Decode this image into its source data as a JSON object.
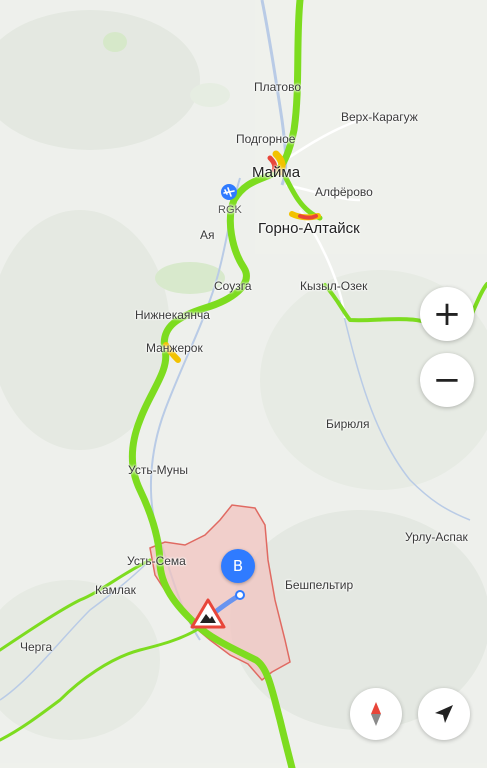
{
  "places": {
    "platovo": "Платово",
    "verkh_karaguzh": "Верх-Карагуж",
    "podgornoe": "Подгорное",
    "mayma": "Майма",
    "alferovo": "Алфёрово",
    "rgk": "RGK",
    "gorno_altaysk": "Горно-Алтайск",
    "aya": "Ая",
    "souzga": "Соузга",
    "kyzyl_ozek": "Кызыл-Озек",
    "nizhnekayancha": "Нижнекаянча",
    "manzherok": "Манжерок",
    "biryulya": "Бирюля",
    "ust_muny": "Усть-Муны",
    "urlu_aspak": "Урлу-Аспак",
    "ust_sema": "Усть-Сема",
    "beshpeltir": "Бешпельтир",
    "kamlak": "Камлак",
    "cherga": "Черга"
  },
  "marker": {
    "label": "B"
  },
  "controls": {
    "zoom_in": "+",
    "zoom_out": "−"
  },
  "icons": {
    "airport": "airplane-icon",
    "warning": "road-warning-icon",
    "compass": "compass-icon",
    "location": "navigation-arrow-icon"
  },
  "colors": {
    "traffic_free": "#7ddc1f",
    "traffic_slow": "#f2c200",
    "traffic_jam": "#e8463a",
    "zone_fill": "#f2c4c0",
    "zone_stroke": "#e06a62",
    "route": "#2f7bff",
    "river": "#b7c9e6"
  }
}
